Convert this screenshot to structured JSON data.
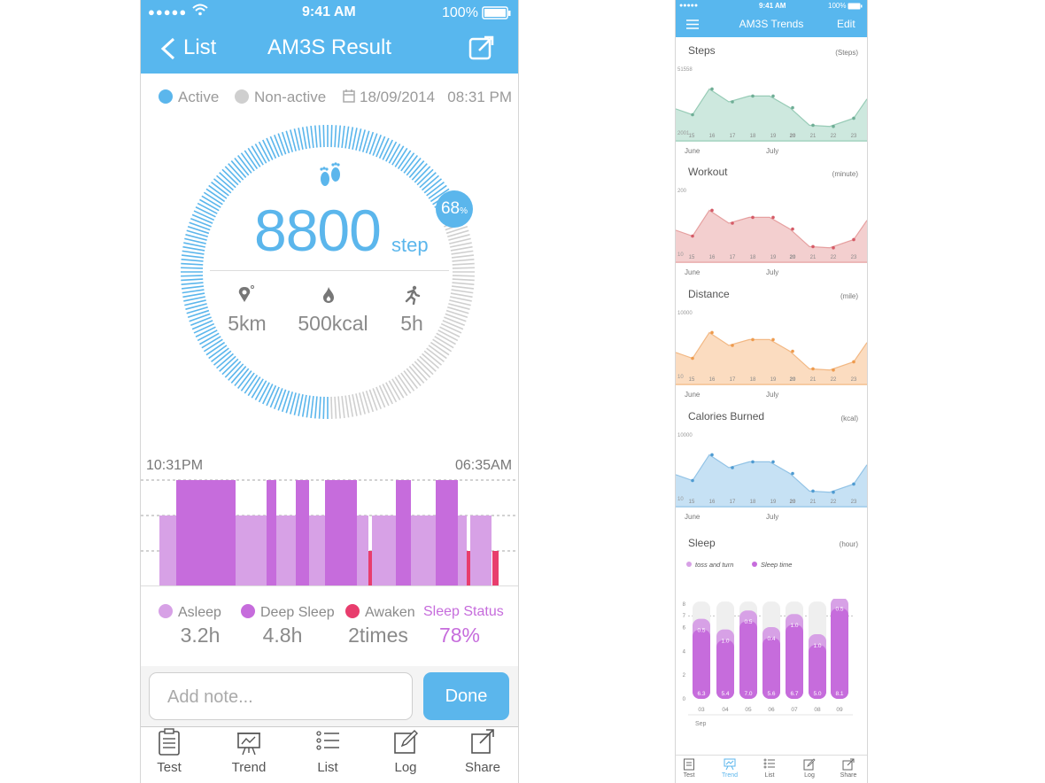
{
  "result_screen": {
    "status": {
      "signal": "●●●●●",
      "time": "9:41 AM",
      "battery": "100%"
    },
    "nav": {
      "back_label": "List",
      "title": "AM3S Result"
    },
    "legend": {
      "active": "Active",
      "non_active": "Non-active",
      "date": "18/09/2014",
      "time": "08:31 PM"
    },
    "colors": {
      "accent": "#5bb6ec",
      "inactive": "#cfcfcf",
      "asleep": "#d7a1e6",
      "deep": "#c66cdc",
      "awake": "#e83d6d"
    },
    "progress": {
      "percent": 68,
      "percent_label": "68",
      "percent_sign": "%",
      "steps": "8800",
      "unit": "step"
    },
    "stats": [
      {
        "icon": "location-pin-icon",
        "value": "5km"
      },
      {
        "icon": "flame-icon",
        "value": "500kcal"
      },
      {
        "icon": "running-icon",
        "value": "5h"
      }
    ],
    "sleep_chart": {
      "start": "10:31PM",
      "end": "06:35AM"
    },
    "sleep_legend": [
      {
        "label": "Asleep",
        "value": "3.2h"
      },
      {
        "label": "Deep Sleep",
        "value": "4.8h"
      },
      {
        "label": "Awaken",
        "value": "2times"
      },
      {
        "label": "Sleep Status",
        "value": "78%"
      }
    ],
    "note": {
      "placeholder": "Add note...",
      "done_label": "Done"
    },
    "tabs": [
      {
        "icon": "clipboard-icon",
        "label": "Test"
      },
      {
        "icon": "trend-icon",
        "label": "Trend"
      },
      {
        "icon": "list-icon",
        "label": "List"
      },
      {
        "icon": "log-icon",
        "label": "Log"
      },
      {
        "icon": "share-icon",
        "label": "Share"
      }
    ]
  },
  "trends_screen": {
    "status": {
      "signal": "●●●●●",
      "time": "9:41 AM",
      "battery": "100%"
    },
    "nav": {
      "menu_icon": "menu-icon",
      "title": "AM3S Trends",
      "edit_label": "Edit"
    },
    "sections": [
      {
        "title": "Steps",
        "unit": "(Steps)",
        "ymax": "51558",
        "ymin": "2001",
        "color": "#cde8de",
        "line": "#97cbb6",
        "dot": "#6fae96"
      },
      {
        "title": "Workout",
        "unit": "(minute)",
        "ymax": "200",
        "ymin": "10",
        "color": "#f3cfcf",
        "line": "#e6a0a0",
        "dot": "#d55b67"
      },
      {
        "title": "Distance",
        "unit": "(mile)",
        "ymax": "10000",
        "ymin": "10",
        "color": "#fbdcc0",
        "line": "#f2b884",
        "dot": "#ee9b4e"
      },
      {
        "title": "Calories Burned",
        "unit": "(kcal)",
        "ymax": "10000",
        "ymin": "10",
        "color": "#c6e1f4",
        "line": "#92c3e6",
        "dot": "#4f9bd1"
      }
    ],
    "x_days": [
      "15",
      "16",
      "17",
      "18",
      "19",
      "20",
      "21",
      "22",
      "23"
    ],
    "months": {
      "left": "June",
      "right": "July"
    },
    "sleep": {
      "title": "Sleep",
      "unit": "(hour)",
      "legend": [
        "toss and turn",
        "Sleep time"
      ],
      "yticks": [
        "8",
        "7",
        "6",
        "4",
        "2",
        "0"
      ],
      "days": [
        "03",
        "04",
        "05",
        "06",
        "07",
        "08",
        "09"
      ],
      "month": "Sep",
      "sleep_time": [
        "6.3",
        "5.4",
        "7.0",
        "5.6",
        "6.7",
        "5.0",
        "8.1"
      ],
      "toss": [
        "0.5",
        "1.0",
        "0.5",
        "0.4",
        "1.0",
        "1.0",
        "0.5"
      ]
    },
    "tabs": [
      "Test",
      "Trend",
      "List",
      "Log",
      "Share"
    ]
  }
}
